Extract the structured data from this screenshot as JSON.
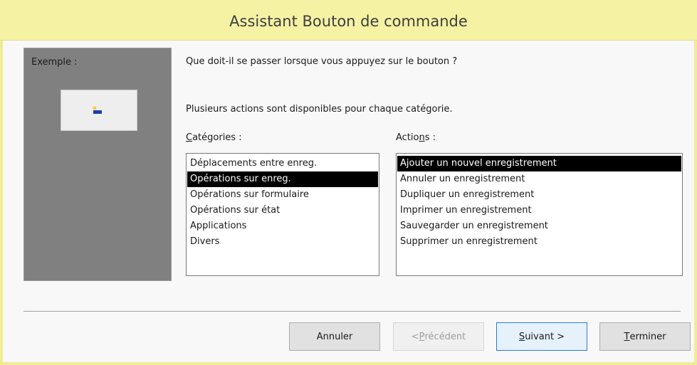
{
  "window": {
    "title": "Assistant Bouton de commande"
  },
  "preview": {
    "label": "Exemple :",
    "sample_icon": "new-record-icon"
  },
  "question": "Que doit-il se passer lorsque vous appuyez sur le bouton ?",
  "info": "Plusieurs actions sont disponibles pour chaque catégorie.",
  "categories": {
    "label_pre": "",
    "label_accel": "C",
    "label_post": "atégories :",
    "items": [
      "Déplacements entre enreg.",
      "Opérations sur enreg.",
      "Opérations sur formulaire",
      "Opérations sur état",
      "Applications",
      "Divers"
    ],
    "selected": "Opérations sur enreg."
  },
  "actions": {
    "label_pre": "Actio",
    "label_accel": "n",
    "label_post": "s :",
    "items": [
      "Ajouter un nouvel enregistrement",
      "Annuler un enregistrement",
      "Dupliquer un enregistrement",
      "Imprimer un enregistrement",
      "Sauvegarder un enregistrement",
      "Supprimer un enregistrement"
    ],
    "selected": "Ajouter un nouvel enregistrement"
  },
  "buttons": {
    "cancel": {
      "pre": "Annuler",
      "accel": "",
      "post": ""
    },
    "previous": {
      "pre": "< ",
      "accel": "P",
      "post": "récédent"
    },
    "next": {
      "pre": "",
      "accel": "S",
      "post": "uivant >"
    },
    "finish": {
      "pre": "",
      "accel": "T",
      "post": "erminer"
    }
  }
}
